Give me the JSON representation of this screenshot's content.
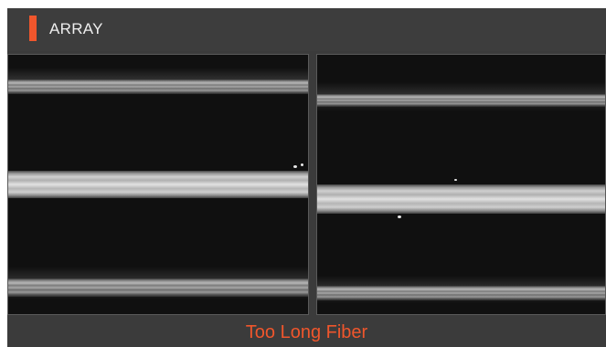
{
  "header": {
    "mode_label": "ARRAY"
  },
  "views": {
    "left": {
      "name": "fiber-camera-view-x"
    },
    "right": {
      "name": "fiber-camera-view-y"
    }
  },
  "status": {
    "message": "Too Long Fiber"
  },
  "colors": {
    "accent": "#f0562c",
    "background": "#3b3b3b",
    "header_text": "#eeeeee",
    "camera_background": "#101010"
  }
}
